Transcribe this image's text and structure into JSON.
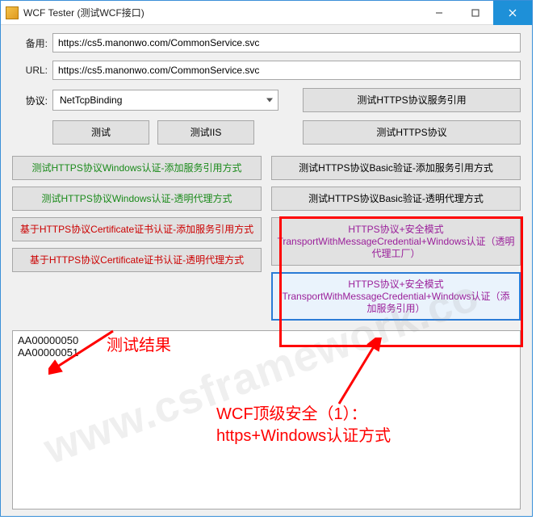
{
  "window": {
    "title": "WCF Tester (测试WCF接口)"
  },
  "form": {
    "backup_label": "备用:",
    "backup_value": "https://cs5.manonwo.com/CommonService.svc",
    "url_label": "URL:",
    "url_value": "https://cs5.manonwo.com/CommonService.svc",
    "protocol_label": "协议:",
    "protocol_value": "NetTcpBinding"
  },
  "buttons": {
    "test": "测试",
    "test_iis": "测试IIS",
    "https_service_ref": "测试HTTPS协议服务引用",
    "https_protocol": "测试HTTPS协议",
    "https_win_auth_ref": "测试HTTPS协议Windows认证-添加服务引用方式",
    "https_win_auth_proxy": "测试HTTPS协议Windows认证-透明代理方式",
    "https_basic_auth_ref": "测试HTTPS协议Basic验证-添加服务引用方式",
    "https_basic_auth_proxy": "测试HTTPS协议Basic验证-透明代理方式",
    "https_cert_ref": "基于HTTPS协议Certificate证书认证-添加服务引用方式",
    "https_cert_proxy": "基于HTTPS协议Certificate证书认证-透明代理方式",
    "https_sec_win_proxy": "HTTPS协议+安全模式TransportWithMessageCredential+Windows认证（透明代理工厂）",
    "https_sec_win_ref": "HTTPS协议+安全模式TransportWithMessageCredential+Windows认证（添加服务引用）"
  },
  "results": {
    "line1": "AA00000050",
    "line2": "AA00000051"
  },
  "annotations": {
    "result_label": "测试结果",
    "caption_line1": "WCF顶级安全（1）：",
    "caption_line2": "https+Windows认证方式"
  },
  "watermark": "www.csframework.co"
}
